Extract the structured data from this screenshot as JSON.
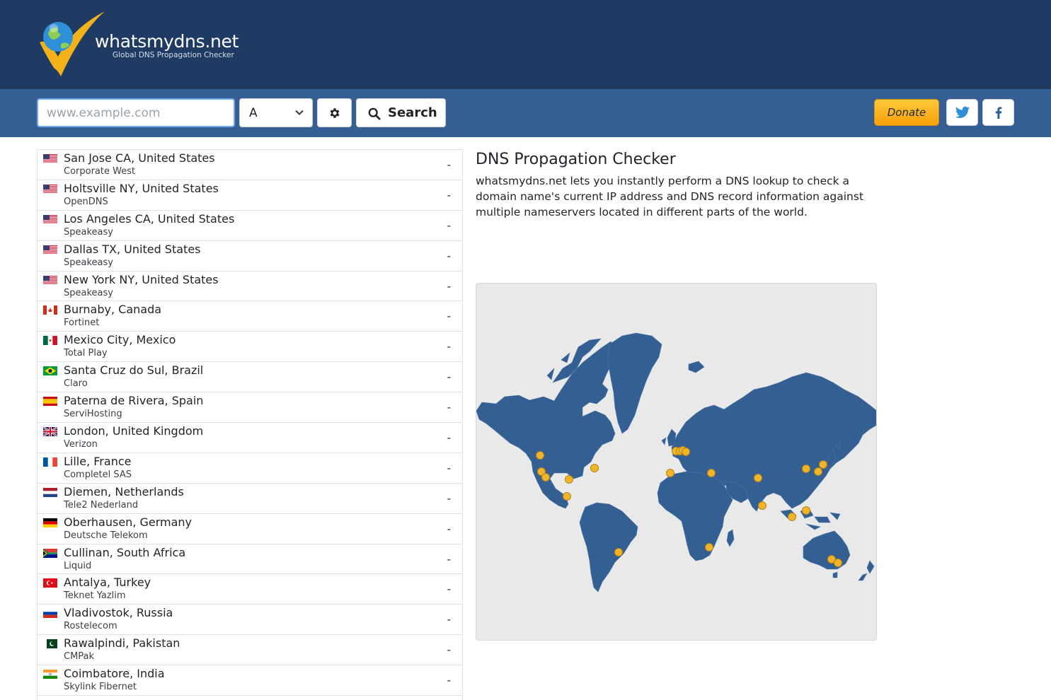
{
  "header": {
    "brand": "whatsmydns.net",
    "tagline": "Global DNS Propagation Checker"
  },
  "search": {
    "placeholder": "www.example.com",
    "value": "",
    "record_type": "A",
    "search_label": "Search",
    "donate_label": "Donate"
  },
  "results": [
    {
      "location": "San Jose CA, United States",
      "provider": "Corporate West",
      "flag": "us",
      "status": "-"
    },
    {
      "location": "Holtsville NY, United States",
      "provider": "OpenDNS",
      "flag": "us",
      "status": "-"
    },
    {
      "location": "Los Angeles CA, United States",
      "provider": "Speakeasy",
      "flag": "us",
      "status": "-"
    },
    {
      "location": "Dallas TX, United States",
      "provider": "Speakeasy",
      "flag": "us",
      "status": "-"
    },
    {
      "location": "New York NY, United States",
      "provider": "Speakeasy",
      "flag": "us",
      "status": "-"
    },
    {
      "location": "Burnaby, Canada",
      "provider": "Fortinet",
      "flag": "ca",
      "status": "-"
    },
    {
      "location": "Mexico City, Mexico",
      "provider": "Total Play",
      "flag": "mx",
      "status": "-"
    },
    {
      "location": "Santa Cruz do Sul, Brazil",
      "provider": "Claro",
      "flag": "br",
      "status": "-"
    },
    {
      "location": "Paterna de Rivera, Spain",
      "provider": "ServiHosting",
      "flag": "es",
      "status": "-"
    },
    {
      "location": "London, United Kingdom",
      "provider": "Verizon",
      "flag": "gb",
      "status": "-"
    },
    {
      "location": "Lille, France",
      "provider": "Completel SAS",
      "flag": "fr",
      "status": "-"
    },
    {
      "location": "Diemen, Netherlands",
      "provider": "Tele2 Nederland",
      "flag": "nl",
      "status": "-"
    },
    {
      "location": "Oberhausen, Germany",
      "provider": "Deutsche Telekom",
      "flag": "de",
      "status": "-"
    },
    {
      "location": "Cullinan, South Africa",
      "provider": "Liquid",
      "flag": "za",
      "status": "-"
    },
    {
      "location": "Antalya, Turkey",
      "provider": "Teknet Yazlim",
      "flag": "tr",
      "status": "-"
    },
    {
      "location": "Vladivostok, Russia",
      "provider": "Rostelecom",
      "flag": "ru",
      "status": "-"
    },
    {
      "location": "Rawalpindi, Pakistan",
      "provider": "CMPak",
      "flag": "pk",
      "status": "-"
    },
    {
      "location": "Coimbatore, India",
      "provider": "Skylink Fibernet",
      "flag": "in",
      "status": "-"
    }
  ],
  "info": {
    "title": "DNS Propagation Checker",
    "description": "whatsmydns.net lets you instantly perform a DNS lookup to check a domain name's current IP address and DNS record information against multiple nameservers located in different parts of the world."
  },
  "icons": {
    "logo": "checkmark-globe-logo",
    "settings": "gear-icon",
    "search": "magnifier-icon",
    "twitter": "twitter-icon",
    "facebook": "facebook-icon",
    "select": "chevron-down-icon"
  },
  "colors": {
    "header_bg": "#1f3a63",
    "search_bar_bg": "#355f93",
    "donate": "#fbb117",
    "map_land": "#345f92",
    "map_marker": "#f0b429"
  }
}
